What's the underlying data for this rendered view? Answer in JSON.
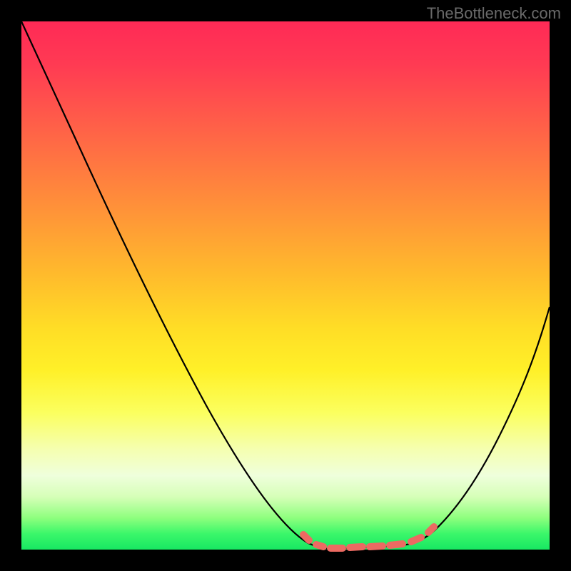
{
  "watermark": "TheBottleneck.com",
  "chart_data": {
    "type": "line",
    "title": "",
    "xlabel": "",
    "ylabel": "",
    "ylim": [
      0,
      100
    ],
    "xlim": [
      0,
      100
    ],
    "series": [
      {
        "name": "curve",
        "x": [
          0,
          10,
          20,
          30,
          40,
          50,
          55,
          60,
          65,
          70,
          75,
          80,
          85,
          90,
          100
        ],
        "values": [
          100,
          86,
          72,
          58,
          44,
          30,
          18,
          8,
          2,
          1,
          1,
          3,
          10,
          20,
          47
        ]
      }
    ],
    "marker_region_x": [
      55,
      78
    ],
    "gradient_colorscale": [
      "#ff2a56",
      "#ffdd26",
      "#18e762"
    ]
  }
}
